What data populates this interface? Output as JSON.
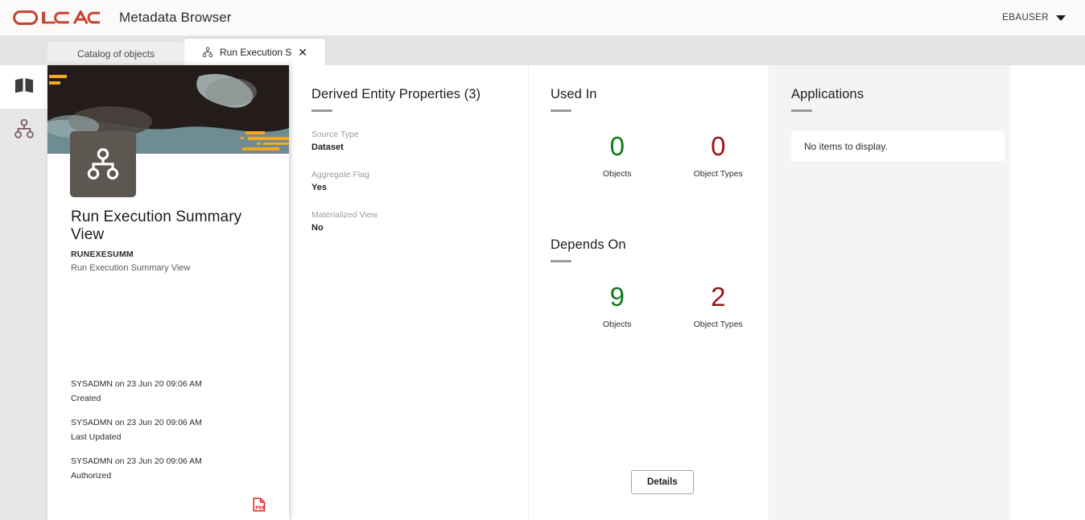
{
  "header": {
    "brand": "ORACLE",
    "app_title": "Metadata Browser",
    "user": "EBAUSER",
    "caret_icon": "chevron-down-icon"
  },
  "tabs": [
    {
      "label": "Catalog of objects",
      "active": false,
      "closable": false
    },
    {
      "label": "Run Execution Summar...",
      "active": true,
      "closable": true,
      "icon": "hierarchy-icon",
      "close_label": "✕"
    }
  ],
  "sidebar": {
    "items": [
      {
        "name": "catalog",
        "icon": "book-icon",
        "selected": true
      },
      {
        "name": "lineage",
        "icon": "hierarchy-icon",
        "selected": false
      }
    ]
  },
  "object_card": {
    "avatar_icon": "hierarchy-icon",
    "title": "Run Execution Summary View",
    "code": "RUNEXESUMM",
    "description": "Run Execution Summary View",
    "audit": [
      {
        "who": "SYSADMN on 23 Jun 20 09:06 AM",
        "what": "Created"
      },
      {
        "who": "SYSADMN on 23 Jun 20 09:06 AM",
        "what": "Last Updated"
      },
      {
        "who": "SYSADMN on 23 Jun 20 09:06 AM",
        "what": "Authorized"
      }
    ],
    "export_icon": "pdf-export-icon"
  },
  "properties": {
    "heading": "Derived Entity Properties (3)",
    "items": [
      {
        "label": "Source Type",
        "value": "Dataset"
      },
      {
        "label": "Aggregate Flag",
        "value": "Yes"
      },
      {
        "label": "Materialized View",
        "value": "No"
      }
    ]
  },
  "used_in": {
    "heading": "Used In",
    "objects_count": "0",
    "objects_label": "Objects",
    "object_types_count": "0",
    "object_types_label": "Object Types"
  },
  "depends_on": {
    "heading": "Depends On",
    "objects_count": "9",
    "objects_label": "Objects",
    "object_types_count": "2",
    "object_types_label": "Object Types",
    "details_button": "Details"
  },
  "applications": {
    "heading": "Applications",
    "empty_message": "No items to display."
  },
  "colors": {
    "brand_red": "#c74634",
    "count_green": "#0f7a1a",
    "count_red": "#961515",
    "banner_dark": "#231c1a",
    "banner_teal": "#6e8c91",
    "banner_orange": "#f5a623"
  }
}
